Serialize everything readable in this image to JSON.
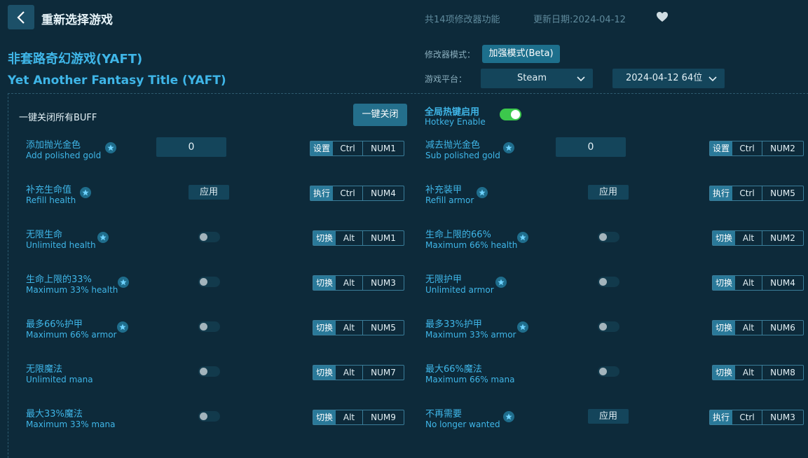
{
  "header": {
    "page_title": "重新选择游戏",
    "feature_count": "共14项修改器功能",
    "update_date": "更新日期:2024-04-12"
  },
  "game": {
    "title_cn": "非套路奇幻游戏(YAFT)",
    "title_en": "Yet Another Fantasy Title (YAFT)"
  },
  "options": {
    "mode_label": "修改器模式：",
    "mode_value": "加强模式(Beta)",
    "platform_label": "游戏平台：",
    "platform_value": "Steam",
    "version_value": "2024-04-12 64位"
  },
  "toolbar": {
    "buff_label": "一键关闭所有BUFF",
    "oneclick_label": "一键关闭",
    "hotkey_cn": "全局热键启用",
    "hotkey_en": "Hotkey Enable",
    "hotkey_enabled": true
  },
  "colors": {
    "accent": "#3fb6e8",
    "background": "#0d2a3a",
    "toggle_on": "#3cc84c"
  },
  "features": [
    {
      "cn": "添加抛光金色",
      "en": "Add polished gold",
      "control": "input",
      "value": "0",
      "action": "设置",
      "mod": "Ctrl",
      "key": "NUM1"
    },
    {
      "cn": "减去抛光金色",
      "en": "Sub polished gold",
      "control": "input",
      "value": "0",
      "action": "设置",
      "mod": "Ctrl",
      "key": "NUM2"
    },
    {
      "cn": "补充生命值",
      "en": "Refill health",
      "control": "button",
      "apply": "应用",
      "action": "执行",
      "mod": "Ctrl",
      "key": "NUM4"
    },
    {
      "cn": "补充装甲",
      "en": "Refill armor",
      "control": "button",
      "apply": "应用",
      "action": "执行",
      "mod": "Ctrl",
      "key": "NUM5"
    },
    {
      "cn": "无限生命",
      "en": "Unlimited health",
      "control": "toggle",
      "on": false,
      "action": "切换",
      "mod": "Alt",
      "key": "NUM1"
    },
    {
      "cn": "生命上限的66%",
      "en": "Maximum 66% health",
      "control": "toggle",
      "on": false,
      "action": "切换",
      "mod": "Alt",
      "key": "NUM2"
    },
    {
      "cn": "生命上限的33%",
      "en": "Maximum 33% health",
      "control": "toggle",
      "on": false,
      "action": "切换",
      "mod": "Alt",
      "key": "NUM3"
    },
    {
      "cn": "无限护甲",
      "en": "Unlimited armor",
      "control": "toggle",
      "on": false,
      "action": "切换",
      "mod": "Alt",
      "key": "NUM4"
    },
    {
      "cn": "最多66%护甲",
      "en": "Maximum 66% armor",
      "control": "toggle",
      "on": false,
      "action": "切换",
      "mod": "Alt",
      "key": "NUM5"
    },
    {
      "cn": "最多33%护甲",
      "en": "Maximum 33% armor",
      "control": "toggle",
      "on": false,
      "action": "切换",
      "mod": "Alt",
      "key": "NUM6"
    },
    {
      "cn": "无限魔法",
      "en": "Unlimited mana",
      "control": "toggle",
      "on": false,
      "action": "切换",
      "mod": "Alt",
      "key": "NUM7"
    },
    {
      "cn": "最大66%魔法",
      "en": "Maximum 66% mana",
      "control": "toggle",
      "on": false,
      "action": "切换",
      "mod": "Alt",
      "key": "NUM8"
    },
    {
      "cn": "最大33%魔法",
      "en": "Maximum 33% mana",
      "control": "toggle",
      "on": false,
      "action": "切换",
      "mod": "Alt",
      "key": "NUM9"
    },
    {
      "cn": "不再需要",
      "en": "No longer wanted",
      "control": "button",
      "apply": "应用",
      "action": "执行",
      "mod": "Ctrl",
      "key": "NUM3"
    }
  ]
}
